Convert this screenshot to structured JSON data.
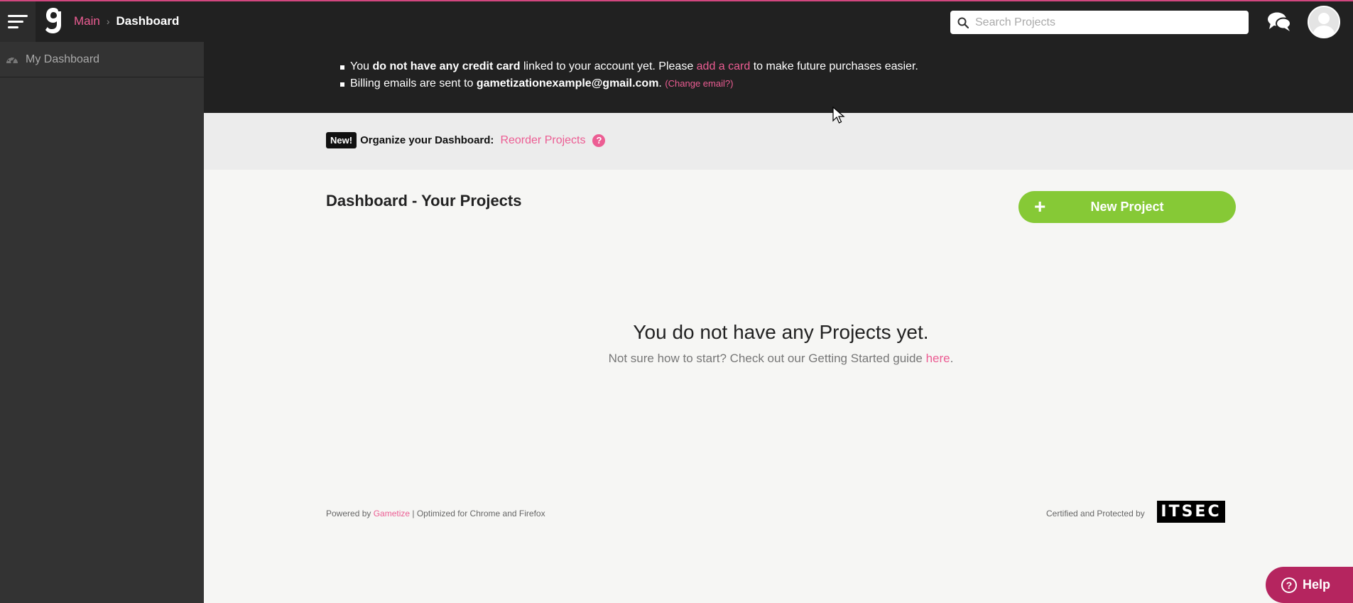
{
  "header": {
    "breadcrumb": {
      "root": "Main",
      "separator": "›",
      "current": "Dashboard"
    },
    "search": {
      "placeholder": "Search Projects",
      "value": ""
    },
    "icons": {
      "menu": "hamburger-menu-icon",
      "logo": "gametize-logo",
      "chat": "chat-bubbles-icon",
      "avatar": "user-avatar"
    }
  },
  "sidebar": {
    "items": [
      {
        "label": "My Dashboard",
        "icon": "dashboard-gauge-icon"
      }
    ]
  },
  "billing": {
    "line1": {
      "pre": "You ",
      "bold": "do not have any credit card",
      "mid": " linked to your account yet. Please ",
      "link": "add a card",
      "post": " to make future purchases easier."
    },
    "line2": {
      "pre": "Billing emails are sent to ",
      "email": "gametizationexample@gmail.com",
      "post": ". ",
      "link": "(Change email?)"
    }
  },
  "organize": {
    "badge": "New!",
    "label": "Organize your Dashboard:",
    "link": "Reorder Projects",
    "help_icon": "?"
  },
  "main": {
    "title": "Dashboard - Your Projects",
    "new_project_button": "New Project",
    "new_project_icon": "+",
    "empty_title": "You do not have any Projects yet.",
    "empty_sub_pre": "Not sure how to start? Check out our Getting Started guide ",
    "empty_sub_link": "here",
    "empty_sub_post": "."
  },
  "footer": {
    "powered_pre": "Powered by ",
    "powered_link": "Gametize",
    "powered_post": " | Optimized for Chrome and Firefox",
    "certified": "Certified and Protected by",
    "certifier_logo": "ITSEC"
  },
  "help": {
    "label": "Help",
    "icon": "?"
  },
  "colors": {
    "accent": "#ec5d93",
    "topbar": "#212121",
    "sidebar": "#333333",
    "green": "#86c936",
    "help": "#b5255f"
  }
}
